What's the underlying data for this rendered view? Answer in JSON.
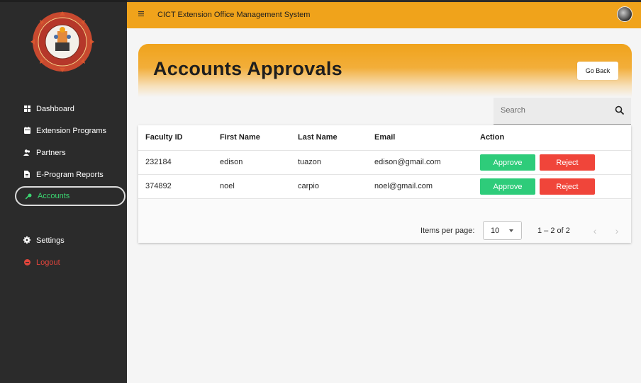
{
  "app": {
    "title": "CICT Extension Office Management System"
  },
  "sidebar": {
    "items": [
      {
        "label": "Dashboard",
        "icon": "dashboard-icon"
      },
      {
        "label": "Extension Programs",
        "icon": "calendar-icon"
      },
      {
        "label": "Partners",
        "icon": "users-icon"
      },
      {
        "label": "E-Program Reports",
        "icon": "document-icon"
      },
      {
        "label": "Accounts",
        "icon": "key-icon",
        "active": true
      },
      {
        "label": "Settings",
        "icon": "gear-icon"
      },
      {
        "label": "Logout",
        "icon": "logout-icon"
      }
    ]
  },
  "header": {
    "title": "Accounts Approvals",
    "go_back": "Go Back"
  },
  "search": {
    "placeholder": "Search"
  },
  "table": {
    "columns": [
      "Faculty ID",
      "First Name",
      "Last Name",
      "Email",
      "Action"
    ],
    "rows": [
      {
        "faculty_id": "232184",
        "first_name": "edison",
        "last_name": "tuazon",
        "email": "edison@gmail.com",
        "approve": "Approve",
        "reject": "Reject"
      },
      {
        "faculty_id": "374892",
        "first_name": "noel",
        "last_name": "carpio",
        "email": "noel@gmail.com",
        "approve": "Approve",
        "reject": "Reject"
      }
    ]
  },
  "paginator": {
    "label": "Items per page:",
    "page_size": "10",
    "range": "1 – 2 of 2",
    "prev_icon": "chevron-left-icon",
    "next_icon": "chevron-right-icon"
  },
  "colors": {
    "accent": "#f0a31b",
    "sidebar_bg": "#2b2b2b",
    "active_nav": "#3bd671",
    "approve": "#2ecc7a",
    "reject": "#f0453a",
    "logout": "#e2453c"
  }
}
